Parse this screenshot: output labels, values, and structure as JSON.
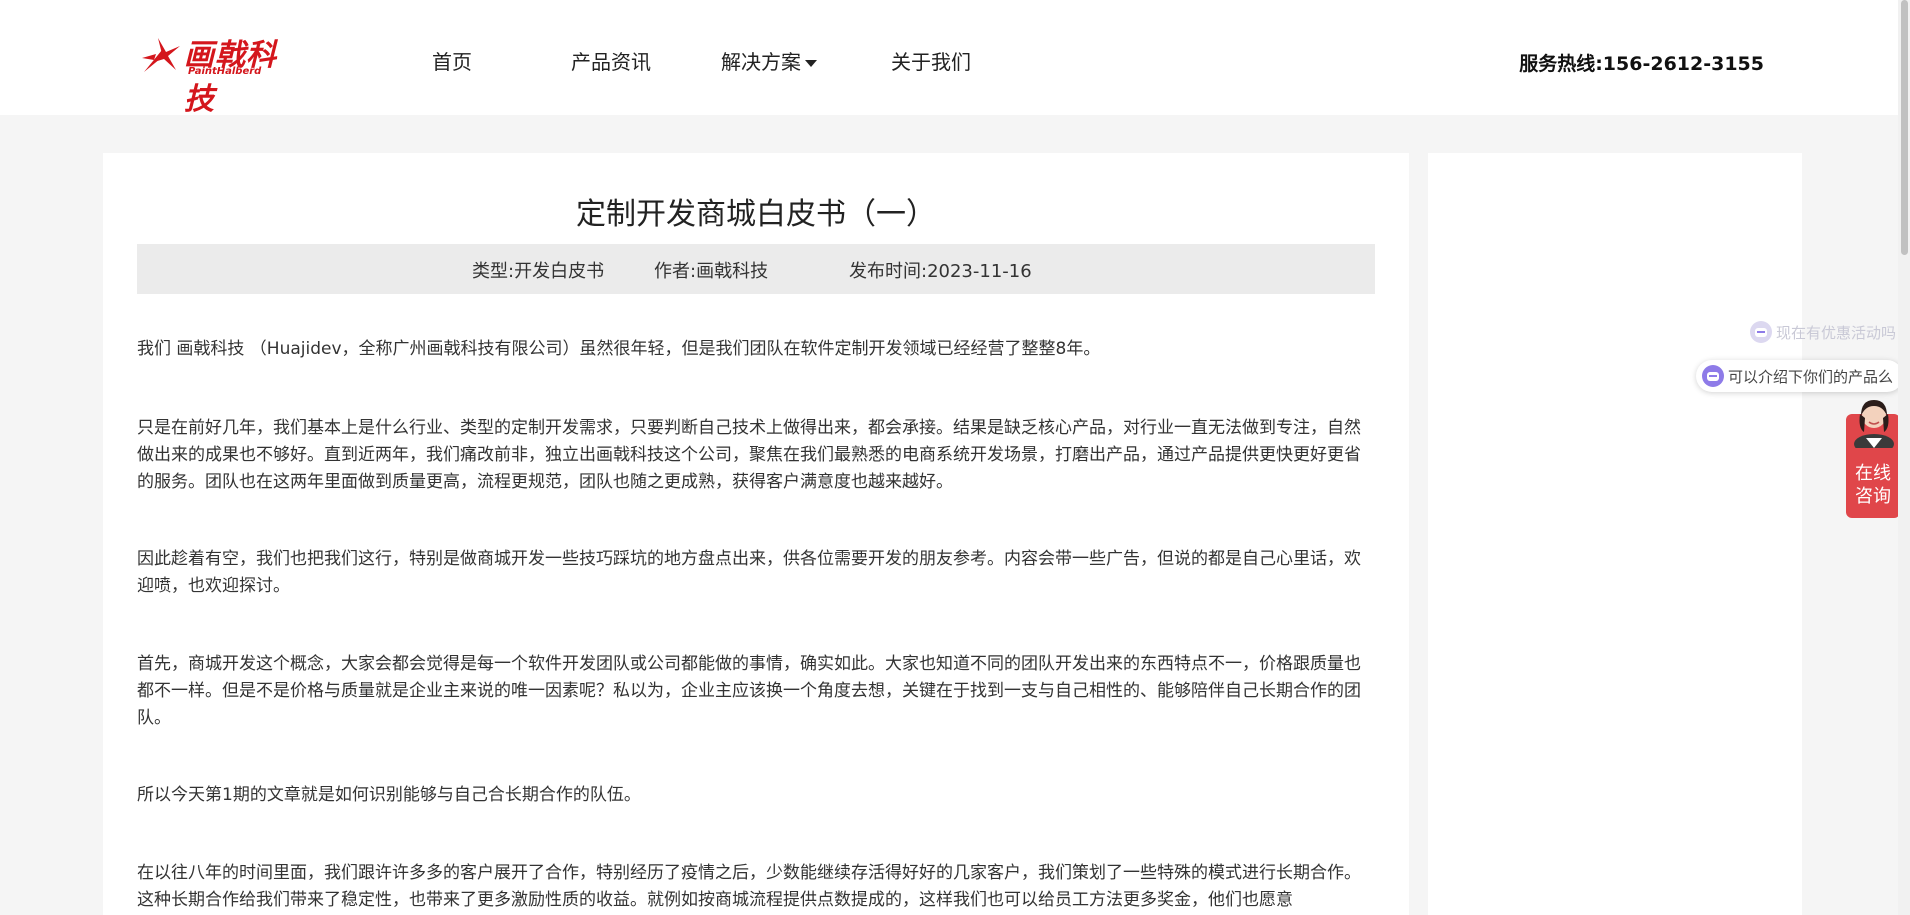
{
  "header": {
    "logo_text": "画戟科技",
    "logo_sub": "PaintHalberd",
    "nav": [
      {
        "label": "首页"
      },
      {
        "label": "产品资讯"
      },
      {
        "label": "解决方案"
      },
      {
        "label": "关于我们"
      }
    ],
    "hotline": "服务热线:156-2612-3155"
  },
  "article": {
    "title": "定制开发商城白皮书（一）",
    "meta": {
      "type": "类型:开发白皮书",
      "author": "作者:画戟科技",
      "date": "发布时间:2023-11-16"
    },
    "paragraphs": [
      "我们 画戟科技 （Huajidev，全称广州画戟科技有限公司）虽然很年轻，但是我们团队在软件定制开发领域已经经营了整整8年。",
      "只是在前好几年，我们基本上是什么行业、类型的定制开发需求，只要判断自己技术上做得出来，都会承接。结果是缺乏核心产品，对行业一直无法做到专注，自然做出来的成果也不够好。直到近两年，我们痛改前非，独立出画戟科技这个公司，聚焦在我们最熟悉的电商系统开发场景，打磨出产品，通过产品提供更快更好更省的服务。团队也在这两年里面做到质量更高，流程更规范，团队也随之更成熟，获得客户满意度也越来越好。",
      "因此趁着有空，我们也把我们这行，特别是做商城开发一些技巧踩坑的地方盘点出来，供各位需要开发的朋友参考。内容会带一些广告，但说的都是自己心里话，欢迎喷，也欢迎探讨。",
      "首先，商城开发这个概念，大家会都会觉得是每一个软件开发团队或公司都能做的事情，确实如此。大家也知道不同的团队开发出来的东西特点不一，价格跟质量也都不一样。但是不是价格与质量就是企业主来说的唯一因素呢？私以为，企业主应该换一个角度去想，关键在于找到一支与自己相性的、能够陪伴自己长期合作的团队。",
      "所以今天第1期的文章就是如何识别能够与自己合长期合作的队伍。",
      "在以往八年的时间里面，我们跟许许多多的客户展开了合作，特别经历了疫情之后，少数能继续存活得好好的几家客户，我们策划了一些特殊的模式进行长期合作。这种长期合作给我们带来了稳定性，也带来了更多激励性质的收益。就例如按商城流程提供点数提成的，这样我们也可以给员工方法更多奖金，他们也愿意"
    ]
  },
  "chat_widget": {
    "bubble_faded": "现在有优惠活动吗",
    "bubble_main": "可以介绍下你们的产品么",
    "consult_line1": "在线",
    "consult_line2": "咨询"
  },
  "colors": {
    "brand": "#d4161c",
    "consult_bg": "#e0464a",
    "chat_icon": "#8e7be8",
    "meta_bg": "#ebebeb",
    "page_bg": "#f5f5f5"
  }
}
